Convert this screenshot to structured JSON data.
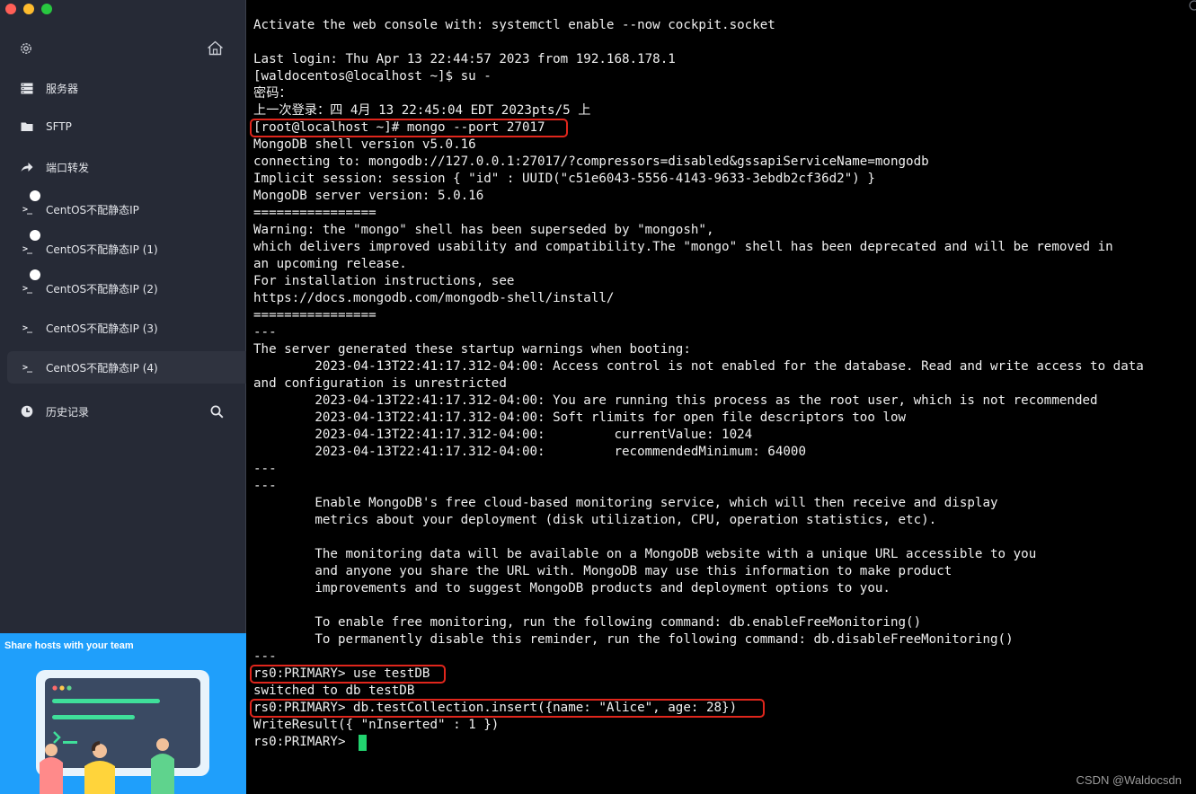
{
  "sidebar": {
    "items": [
      {
        "label": "服务器",
        "icon": "server-icon"
      },
      {
        "label": "SFTP",
        "icon": "folder-icon"
      },
      {
        "label": "端口转发",
        "icon": "port-forward-icon"
      },
      {
        "label": "CentOS不配静态IP",
        "icon": "terminal-icon"
      },
      {
        "label": "CentOS不配静态IP (1)",
        "icon": "terminal-icon"
      },
      {
        "label": "CentOS不配静态IP (2)",
        "icon": "terminal-icon"
      },
      {
        "label": "CentOS不配静态IP (3)",
        "icon": "terminal-icon"
      },
      {
        "label": "CentOS不配静态IP (4)",
        "icon": "terminal-icon"
      },
      {
        "label": "历史记录",
        "icon": "history-icon"
      }
    ],
    "active_index": 7,
    "promo_title": "Share hosts with your team"
  },
  "terminal": {
    "lines": [
      "Activate the web console with: systemctl enable --now cockpit.socket",
      "",
      "Last login: Thu Apr 13 22:44:57 2023 from 192.168.178.1",
      "[waldocentos@localhost ~]$ su -",
      "密码：",
      "上一次登录：四 4月 13 22:45:04 EDT 2023pts/5 上",
      "[root@localhost ~]# mongo --port 27017",
      "MongoDB shell version v5.0.16",
      "connecting to: mongodb://127.0.0.1:27017/?compressors=disabled&gssapiServiceName=mongodb",
      "Implicit session: session { \"id\" : UUID(\"c51e6043-5556-4143-9633-3ebdb2cf36d2\") }",
      "MongoDB server version: 5.0.16",
      "================",
      "Warning: the \"mongo\" shell has been superseded by \"mongosh\",",
      "which delivers improved usability and compatibility.The \"mongo\" shell has been deprecated and will be removed in",
      "an upcoming release.",
      "For installation instructions, see",
      "https://docs.mongodb.com/mongodb-shell/install/",
      "================",
      "---",
      "The server generated these startup warnings when booting:",
      "        2023-04-13T22:41:17.312-04:00: Access control is not enabled for the database. Read and write access to data",
      "and configuration is unrestricted",
      "        2023-04-13T22:41:17.312-04:00: You are running this process as the root user, which is not recommended",
      "        2023-04-13T22:41:17.312-04:00: Soft rlimits for open file descriptors too low",
      "        2023-04-13T22:41:17.312-04:00:         currentValue: 1024",
      "        2023-04-13T22:41:17.312-04:00:         recommendedMinimum: 64000",
      "---",
      "---",
      "        Enable MongoDB's free cloud-based monitoring service, which will then receive and display",
      "        metrics about your deployment (disk utilization, CPU, operation statistics, etc).",
      "",
      "        The monitoring data will be available on a MongoDB website with a unique URL accessible to you",
      "        and anyone you share the URL with. MongoDB may use this information to make product",
      "        improvements and to suggest MongoDB products and deployment options to you.",
      "",
      "        To enable free monitoring, run the following command: db.enableFreeMonitoring()",
      "        To permanently disable this reminder, run the following command: db.disableFreeMonitoring()",
      "---",
      "rs0:PRIMARY> use testDB",
      "switched to db testDB",
      "rs0:PRIMARY> db.testCollection.insert({name: \"Alice\", age: 28})",
      "WriteResult({ \"nInserted\" : 1 })",
      "rs0:PRIMARY> "
    ]
  },
  "watermark": "CSDN @Waldocsdn",
  "colors": {
    "sidebar_bg": "#262a36",
    "terminal_bg": "#000000",
    "highlight_border": "#e0261c",
    "cursor": "#22d36f",
    "promo_bg": "#1f9ffb"
  }
}
